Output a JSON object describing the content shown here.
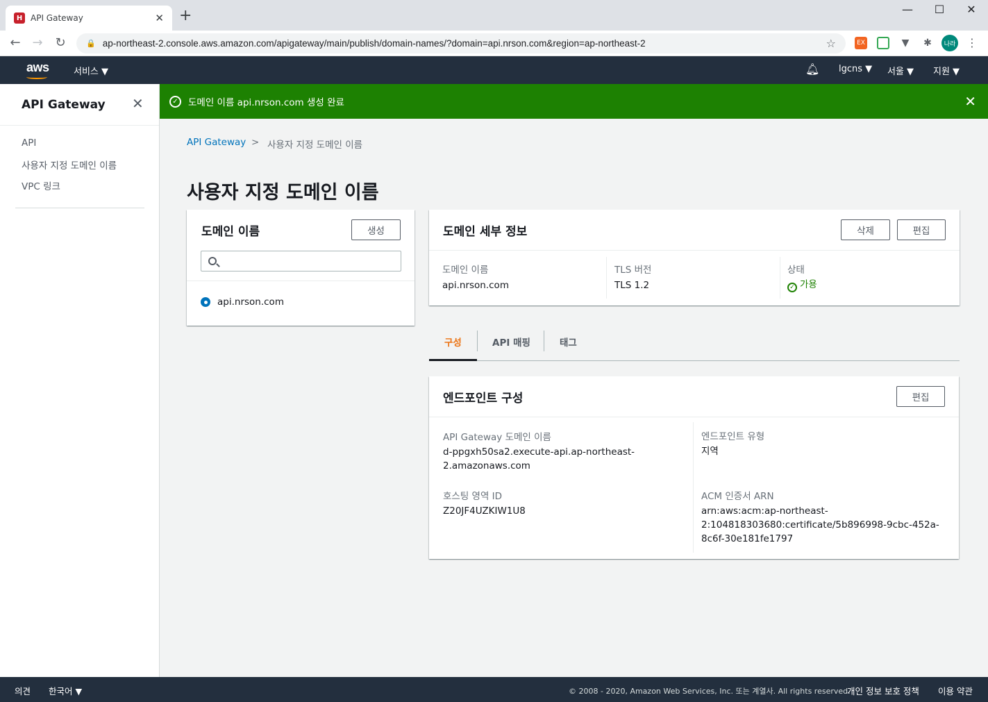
{
  "browser": {
    "tab_title": "API Gateway",
    "tab_favicon": "H",
    "url": "ap-northeast-2.console.aws.amazon.com/apigateway/main/publish/domain-names/?domain=api.nrson.com&region=ap-northeast-2",
    "avatar_text": "나라",
    "ext1_text": "EX"
  },
  "aws_header": {
    "logo": "aws",
    "services": "서비스 ▼",
    "account": "lgcns ▼",
    "region": "서울 ▼",
    "support": "지원 ▼"
  },
  "sidebar": {
    "title": "API Gateway",
    "items": [
      {
        "label": "API"
      },
      {
        "label": "사용자 지정 도메인 이름"
      },
      {
        "label": "VPC 링크"
      }
    ]
  },
  "flash": {
    "message": "도메인 이름 api.nrson.com 생성 완료"
  },
  "breadcrumb": {
    "root": "API Gateway",
    "separator": ">",
    "current": "사용자 지정 도메인 이름"
  },
  "page_title": "사용자 지정 도메인 이름",
  "domain_list": {
    "title": "도메인 이름",
    "create_label": "생성",
    "search_placeholder": "",
    "items": [
      {
        "label": "api.nrson.com",
        "selected": true
      }
    ]
  },
  "domain_details": {
    "title": "도메인 세부 정보",
    "delete_label": "삭제",
    "edit_label": "편집",
    "fields": [
      {
        "label": "도메인 이름",
        "value": "api.nrson.com"
      },
      {
        "label": "TLS 버전",
        "value": "TLS 1.2"
      },
      {
        "label": "상태",
        "value": "가용"
      }
    ],
    "status_color": "#1d8102"
  },
  "tabs": [
    {
      "label": "구성",
      "active": true
    },
    {
      "label": "API 매핑",
      "active": false
    },
    {
      "label": "태그",
      "active": false
    }
  ],
  "endpoint": {
    "title": "엔드포인트 구성",
    "edit_label": "편집",
    "gw_domain_label": "API Gateway 도메인 이름",
    "gw_domain_value_1": "d-ppgxh50sa2.execute-api.ap-northeast-",
    "gw_domain_value_2": "2.amazonaws.com",
    "zone_label": "호스팅 영역 ID",
    "zone_value": "Z20JF4UZKIW1U8",
    "type_label": "엔드포인트 유형",
    "type_value": "지역",
    "acm_label": "ACM 인증서 ARN",
    "acm_value_1": "arn:aws:acm:ap-northeast-",
    "acm_value_2": "2:104818303680:certificate/5b896998-9cbc-452a-",
    "acm_value_3": "8c6f-30e181fe1797"
  },
  "footer": {
    "feedback": "의견",
    "language": "한국어 ▼",
    "copyright": "© 2008 - 2020, Amazon Web Services, Inc. 또는 계열사. All rights reserved.",
    "privacy": "개인 정보 보호 정책",
    "terms": "이용 약관"
  },
  "colors": {
    "aws_dark": "#232f3e",
    "flash_success": "#1d8102",
    "link": "#0073bb",
    "tab_active": "#ec7211"
  }
}
